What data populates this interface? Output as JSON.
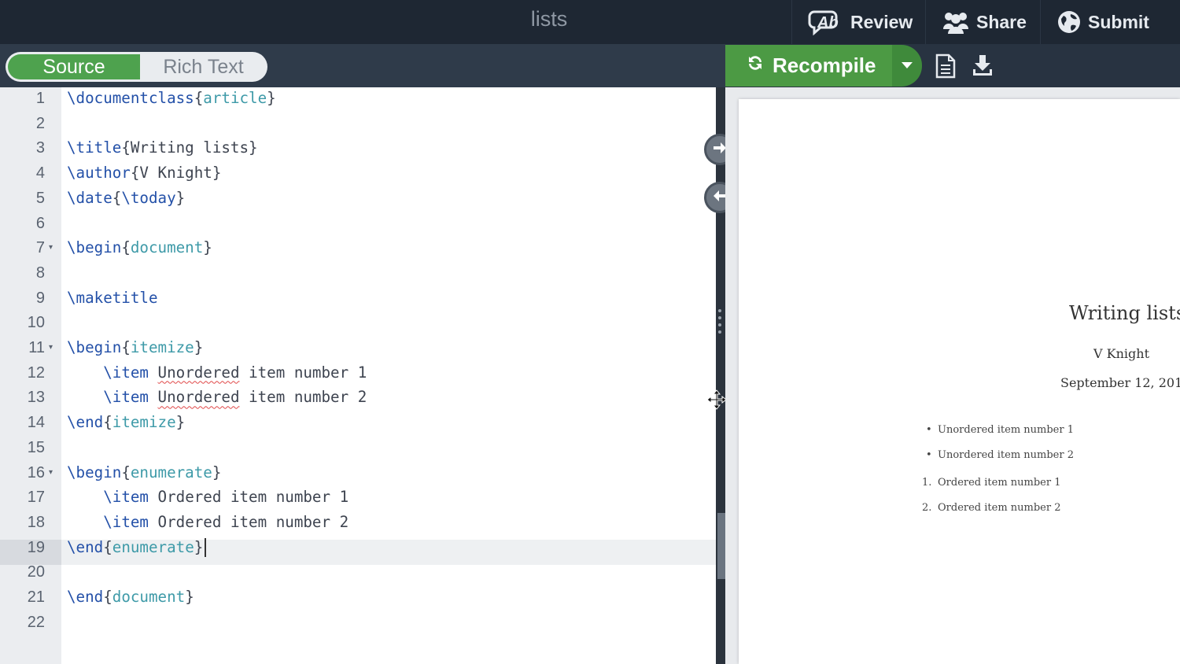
{
  "topbar": {
    "title": "lists",
    "review_label": "Review",
    "share_label": "Share",
    "submit_label": "Submit"
  },
  "toolbar": {
    "source_label": "Source",
    "rich_text_label": "Rich Text",
    "recompile_label": "Recompile"
  },
  "colors": {
    "topbar_bg": "#1e2733",
    "accent_green": "#4c9a44",
    "command_blue": "#2350a8",
    "argument_teal": "#3e9aa8"
  },
  "editor": {
    "active_line": 19,
    "lines": [
      {
        "n": "1",
        "parts": [
          [
            "cmd",
            "\\documentclass"
          ],
          [
            "p",
            "{"
          ],
          [
            "arg",
            "article"
          ],
          [
            "p",
            "}"
          ]
        ]
      },
      {
        "n": "2",
        "parts": []
      },
      {
        "n": "3",
        "parts": [
          [
            "cmd",
            "\\title"
          ],
          [
            "p",
            "{Writing lists}"
          ]
        ]
      },
      {
        "n": "4",
        "parts": [
          [
            "cmd",
            "\\author"
          ],
          [
            "p",
            "{V Knight}"
          ]
        ]
      },
      {
        "n": "5",
        "parts": [
          [
            "cmd",
            "\\date"
          ],
          [
            "p",
            "{"
          ],
          [
            "cmd",
            "\\today"
          ],
          [
            "p",
            "}"
          ]
        ]
      },
      {
        "n": "6",
        "parts": []
      },
      {
        "n": "7",
        "fold": true,
        "parts": [
          [
            "cmd",
            "\\begin"
          ],
          [
            "p",
            "{"
          ],
          [
            "arg",
            "document"
          ],
          [
            "p",
            "}"
          ]
        ]
      },
      {
        "n": "8",
        "parts": []
      },
      {
        "n": "9",
        "parts": [
          [
            "cmd",
            "\\maketitle"
          ]
        ]
      },
      {
        "n": "10",
        "parts": []
      },
      {
        "n": "11",
        "fold": true,
        "parts": [
          [
            "cmd",
            "\\begin"
          ],
          [
            "p",
            "{"
          ],
          [
            "arg",
            "itemize"
          ],
          [
            "p",
            "}"
          ]
        ]
      },
      {
        "n": "12",
        "parts": [
          [
            "p",
            "    "
          ],
          [
            "cmd",
            "\\item"
          ],
          [
            "p",
            " "
          ],
          [
            "sq",
            "Unordered"
          ],
          [
            "p",
            " item number 1"
          ]
        ]
      },
      {
        "n": "13",
        "parts": [
          [
            "p",
            "    "
          ],
          [
            "cmd",
            "\\item"
          ],
          [
            "p",
            " "
          ],
          [
            "sq",
            "Unordered"
          ],
          [
            "p",
            " item number 2"
          ]
        ]
      },
      {
        "n": "14",
        "parts": [
          [
            "cmd",
            "\\end"
          ],
          [
            "p",
            "{"
          ],
          [
            "arg",
            "itemize"
          ],
          [
            "p",
            "}"
          ]
        ]
      },
      {
        "n": "15",
        "parts": []
      },
      {
        "n": "16",
        "fold": true,
        "parts": [
          [
            "cmd",
            "\\begin"
          ],
          [
            "p",
            "{"
          ],
          [
            "arg",
            "enumerate"
          ],
          [
            "p",
            "}"
          ]
        ]
      },
      {
        "n": "17",
        "parts": [
          [
            "p",
            "    "
          ],
          [
            "cmd",
            "\\item"
          ],
          [
            "p",
            " Ordered item number 1"
          ]
        ]
      },
      {
        "n": "18",
        "parts": [
          [
            "p",
            "    "
          ],
          [
            "cmd",
            "\\item"
          ],
          [
            "p",
            " Ordered item number 2"
          ]
        ]
      },
      {
        "n": "19",
        "cursor": true,
        "parts": [
          [
            "cmd",
            "\\end"
          ],
          [
            "p",
            "{"
          ],
          [
            "arg",
            "enumerate"
          ],
          [
            "p",
            "}"
          ]
        ]
      },
      {
        "n": "20",
        "parts": []
      },
      {
        "n": "21",
        "parts": [
          [
            "cmd",
            "\\end"
          ],
          [
            "p",
            "{"
          ],
          [
            "arg",
            "document"
          ],
          [
            "p",
            "}"
          ]
        ]
      },
      {
        "n": "22",
        "parts": []
      }
    ]
  },
  "pdf": {
    "title": "Writing lists",
    "author": "V Knight",
    "date": "September 12, 201",
    "items": [
      {
        "marker": "•",
        "text": "Unordered item number 1"
      },
      {
        "marker": "•",
        "text": "Unordered item number 2"
      },
      {
        "marker": "1.",
        "text": "Ordered item number 1"
      },
      {
        "marker": "2.",
        "text": "Ordered item number 2"
      }
    ]
  }
}
